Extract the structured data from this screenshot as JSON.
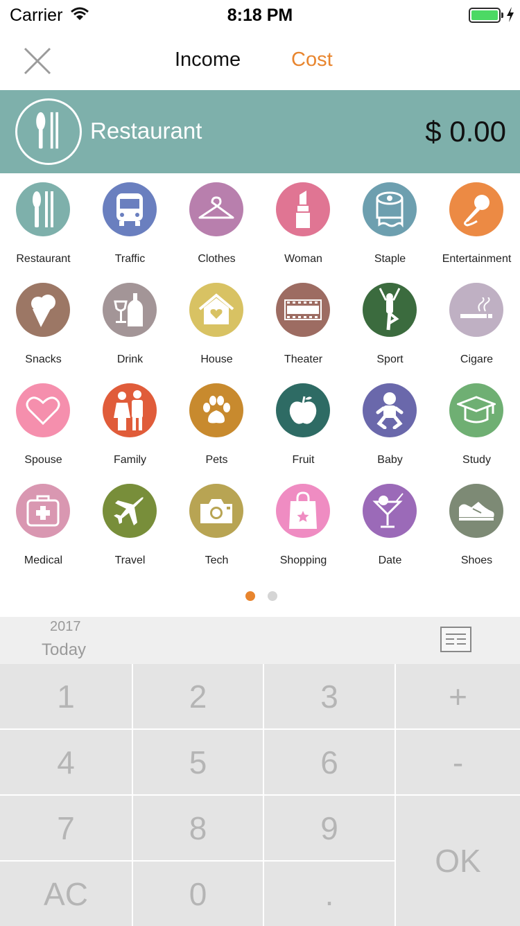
{
  "status_bar": {
    "carrier": "Carrier",
    "time": "8:18 PM"
  },
  "nav": {
    "tabs": [
      {
        "label": "Income"
      },
      {
        "label": "Cost"
      }
    ],
    "active_tab": "Cost",
    "accent": "#e8852e"
  },
  "header": {
    "category": "Restaurant",
    "amount": "$ 0.00",
    "color": "#7eb0ab"
  },
  "categories": [
    {
      "label": "Restaurant",
      "icon": "utensils-icon",
      "color": "#7eb0ab"
    },
    {
      "label": "Traffic",
      "icon": "bus-icon",
      "color": "#6a7fbf"
    },
    {
      "label": "Clothes",
      "icon": "hanger-icon",
      "color": "#b87fad"
    },
    {
      "label": "Woman",
      "icon": "lipstick-icon",
      "color": "#e07593"
    },
    {
      "label": "Staple",
      "icon": "toilet-paper-icon",
      "color": "#6d9faf"
    },
    {
      "label": "Entertainment",
      "icon": "microphone-icon",
      "color": "#ec8a44"
    },
    {
      "label": "Snacks",
      "icon": "ice-cream-icon",
      "color": "#9c7765"
    },
    {
      "label": "Drink",
      "icon": "wine-icon",
      "color": "#a39597"
    },
    {
      "label": "House",
      "icon": "house-icon",
      "color": "#d8c263"
    },
    {
      "label": "Theater",
      "icon": "film-icon",
      "color": "#9d6c62"
    },
    {
      "label": "Sport",
      "icon": "yoga-icon",
      "color": "#3b6b3e"
    },
    {
      "label": "Cigare",
      "icon": "cigarette-icon",
      "color": "#bfb0c3"
    },
    {
      "label": "Spouse",
      "icon": "heart-icon",
      "color": "#f58fad"
    },
    {
      "label": "Family",
      "icon": "family-icon",
      "color": "#e05c3a"
    },
    {
      "label": "Pets",
      "icon": "paw-icon",
      "color": "#c88a2e"
    },
    {
      "label": "Fruit",
      "icon": "apple-icon",
      "color": "#2e6b64"
    },
    {
      "label": "Baby",
      "icon": "baby-icon",
      "color": "#6a68ab"
    },
    {
      "label": "Study",
      "icon": "graduation-cap-icon",
      "color": "#6faf73"
    },
    {
      "label": "Medical",
      "icon": "first-aid-icon",
      "color": "#d997b1"
    },
    {
      "label": "Travel",
      "icon": "airplane-icon",
      "color": "#788e3a"
    },
    {
      "label": "Tech",
      "icon": "camera-icon",
      "color": "#b8a453"
    },
    {
      "label": "Shopping",
      "icon": "shopping-bag-icon",
      "color": "#ef8cc2"
    },
    {
      "label": "Date",
      "icon": "cocktail-icon",
      "color": "#9b6ab8"
    },
    {
      "label": "Shoes",
      "icon": "sneaker-icon",
      "color": "#7d8a75"
    }
  ],
  "pagination": {
    "pages": 2,
    "current": 1
  },
  "date": {
    "year": "2017",
    "label": "Today"
  },
  "keypad": {
    "k1": "1",
    "k2": "2",
    "k3": "3",
    "plus": "+",
    "k4": "4",
    "k5": "5",
    "k6": "6",
    "minus": "-",
    "k7": "7",
    "k8": "8",
    "k9": "9",
    "ok": "OK",
    "ac": "AC",
    "k0": "0",
    "dot": "."
  }
}
